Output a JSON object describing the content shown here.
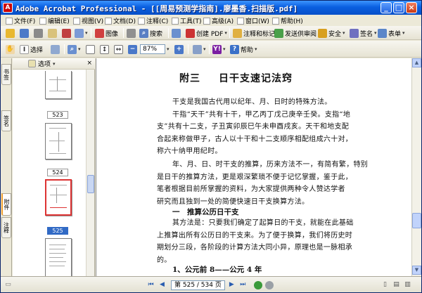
{
  "window": {
    "title": "Adobe Acrobat Professional - [[周易预测学指南].廖墨香.扫描版.pdf]",
    "minimize": "_",
    "restore": "□",
    "close": "×"
  },
  "menu": {
    "items": [
      {
        "label": "文件(F)",
        "icon": "file-menu-icon"
      },
      {
        "label": "编辑(E)",
        "icon": "edit-menu-icon"
      },
      {
        "label": "视图(V)",
        "icon": "view-menu-icon"
      },
      {
        "label": "文档(D)",
        "icon": "document-menu-icon"
      },
      {
        "label": "注释(C)",
        "icon": "comments-menu-icon"
      },
      {
        "label": "工具(T)",
        "icon": "tools-menu-icon"
      },
      {
        "label": "高级(A)",
        "icon": "advanced-menu-icon"
      },
      {
        "label": "窗口(W)",
        "icon": "window-menu-icon"
      },
      {
        "label": "帮助(H)",
        "icon": "help-menu-icon"
      }
    ]
  },
  "toolbar1": {
    "picture_label": "图像",
    "search_label": "搜索",
    "create_pdf_label": "创建 PDF",
    "comment_label": "注释和标记",
    "review_label": "发送供审阅",
    "security_label": "安全",
    "sign_label": "签名",
    "forms_label": "表单"
  },
  "toolbar2": {
    "select_label": "选择",
    "zoom_value": "87%",
    "help_label": "帮助",
    "yahoo_label": "Y!"
  },
  "sidepanel": {
    "options_label": "选项",
    "tabs": [
      "书签",
      "签名",
      "附件",
      "注释"
    ],
    "thumbnails": [
      {
        "page": "523",
        "selected": false
      },
      {
        "page": "524",
        "selected": false
      },
      {
        "page": "525",
        "selected": true
      }
    ]
  },
  "document": {
    "chapter": "附三",
    "title": "日干支速记法窍",
    "para1": [
      "干支是我国古代用以纪年、月、日时的特殊方法。",
      "干指“天干”共有十干，甲乙丙丁戊己庚辛壬癸。支指“地",
      "支”共有十二支，子丑寅卯辰巳午未申酉戌亥。天干和地支配",
      "合起来称做甲子，古人以十干和十二支顺序相配组成六十对，",
      "称六十纳甲用纪时。"
    ],
    "para2": [
      "年、月、日、时干支的推算，历来方法不一，有简有繁，特别",
      "是日干的推算方法，更是艰深繁琐不便于记忆掌握，鉴于此，",
      "笔者根据目前所掌握的资料，为大家提供两种令人赞达学者",
      "研究而且独到一处的简便快速日干支换算方法。"
    ],
    "heading1": "一　推算公历日干支",
    "para3": [
      "其方法是：只要我们确定了起算日的干支，就能在此基础",
      "上推算出所有公历日的干支来。为了便于换算，我们将历史时",
      "期划分三段，各阶段的计算方法大同小异，原理也是一脉相承",
      "的。"
    ],
    "heading2": "1、公元前 8——公元 4 年"
  },
  "statusbar": {
    "page_display": "第 525 / 534 页"
  }
}
